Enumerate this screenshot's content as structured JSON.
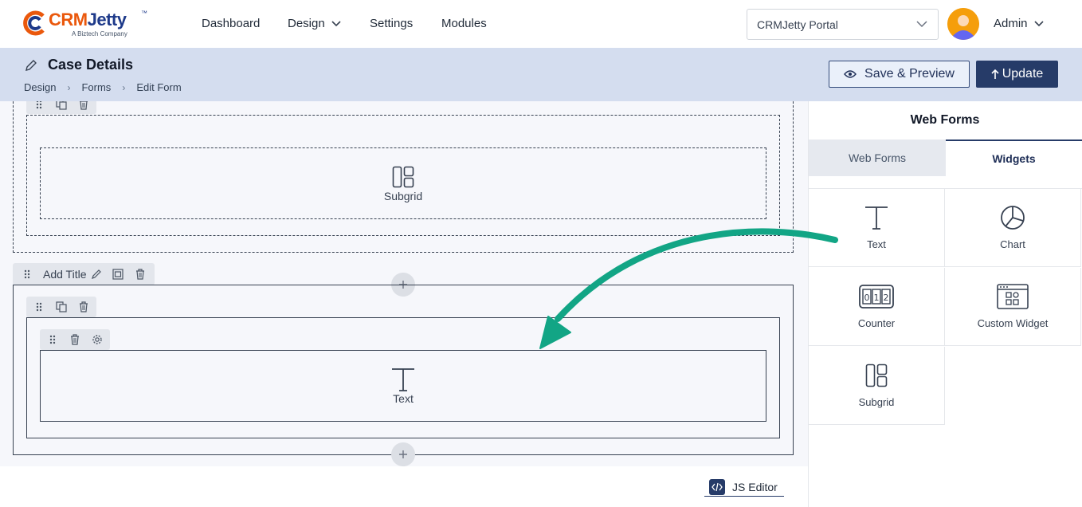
{
  "app": {
    "logo_text": "CRMJetty",
    "logo_sub": "A Biztech Company",
    "logo_tm": "™"
  },
  "nav": {
    "items": [
      {
        "label": "Dashboard"
      },
      {
        "label": "Design"
      },
      {
        "label": "Settings"
      },
      {
        "label": "Modules"
      }
    ],
    "portal_select": "CRMJetty Portal",
    "user": "Admin"
  },
  "header": {
    "title": "Case Details",
    "breadcrumb": [
      "Design",
      "Forms",
      "Edit Form"
    ],
    "save_preview_label": "Save & Preview",
    "update_label": "Update"
  },
  "canvas": {
    "section1_field_label": "Subgrid",
    "section2_title_placeholder": "Add Title",
    "section2_field_label": "Text"
  },
  "footer": {
    "js_editor_label": "JS Editor"
  },
  "panel": {
    "title": "Web Forms",
    "tabs": [
      {
        "label": "Web Forms",
        "active": false
      },
      {
        "label": "Widgets",
        "active": true
      }
    ],
    "widgets": [
      {
        "label": "Text",
        "icon": "text-icon"
      },
      {
        "label": "Chart",
        "icon": "pie-chart-icon"
      },
      {
        "label": "Counter",
        "icon": "counter-icon"
      },
      {
        "label": "Custom Widget",
        "icon": "custom-widget-icon"
      },
      {
        "label": "Subgrid",
        "icon": "subgrid-icon"
      }
    ]
  },
  "colors": {
    "primary": "#263b68",
    "header_band": "#d4ddef",
    "arrow": "#12a585",
    "logo_accent": "#ea580c"
  }
}
